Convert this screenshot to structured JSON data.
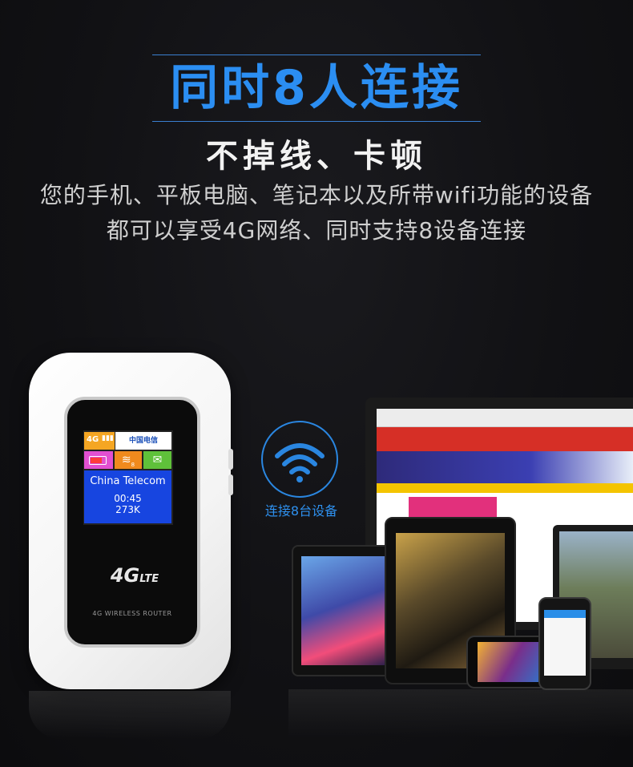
{
  "headline": "同时8人连接",
  "subhead": "不掉线、卡顿",
  "description": {
    "line1": "您的手机、平板电脑、笔记本以及所带wifi功能的设备",
    "line2": "都可以享受4G网络、同时支持8设备连接"
  },
  "router": {
    "screen": {
      "network_badge": "4G",
      "carrier_logo_text": "中国电信",
      "operator": "China Telecom",
      "time": "00:45",
      "data": "273K",
      "wifi_clients": "8"
    },
    "logo": "4G",
    "logo_suffix": "LTE",
    "caption": "4G WIRELESS ROUTER"
  },
  "wifi_badge": {
    "icon": "wifi-icon",
    "caption": "连接8台设备"
  },
  "colors": {
    "accent_blue": "#2b8ef2",
    "background": "#111114"
  }
}
